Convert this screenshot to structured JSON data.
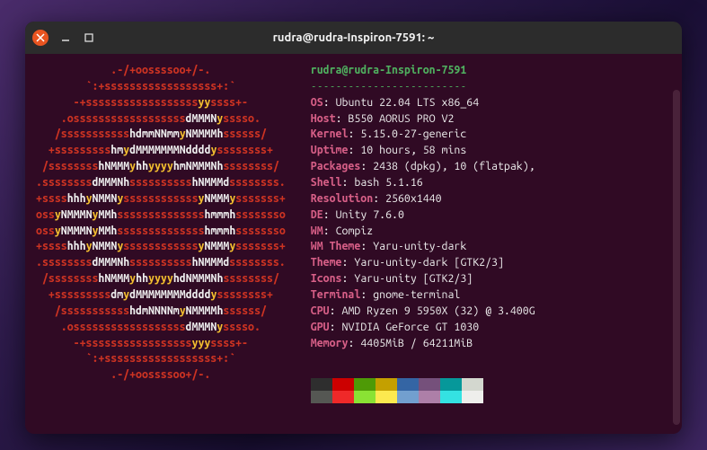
{
  "window": {
    "title": "rudra@rudra-Inspiron-7591: ~"
  },
  "neofetch": {
    "user_host": "rudra@rudra-Inspiron-7591",
    "separator": "-------------------------",
    "info": [
      {
        "key": "OS",
        "val": "Ubuntu 22.04 LTS x86_64"
      },
      {
        "key": "Host",
        "val": "B550 AORUS PRO V2"
      },
      {
        "key": "Kernel",
        "val": "5.15.0-27-generic"
      },
      {
        "key": "Uptime",
        "val": "10 hours, 58 mins"
      },
      {
        "key": "Packages",
        "val": "2438 (dpkg), 10 (flatpak),"
      },
      {
        "key": "Shell",
        "val": "bash 5.1.16"
      },
      {
        "key": "Resolution",
        "val": "2560x1440"
      },
      {
        "key": "DE",
        "val": "Unity 7.6.0"
      },
      {
        "key": "WM",
        "val": "Compiz"
      },
      {
        "key": "WM Theme",
        "val": "Yaru-unity-dark"
      },
      {
        "key": "Theme",
        "val": "Yaru-unity-dark [GTK2/3]"
      },
      {
        "key": "Icons",
        "val": "Yaru-unity [GTK2/3]"
      },
      {
        "key": "Terminal",
        "val": "gnome-terminal"
      },
      {
        "key": "CPU",
        "val": "AMD Ryzen 9 5950X (32) @ 3.400G"
      },
      {
        "key": "GPU",
        "val": "NVIDIA GeForce GT 1030"
      },
      {
        "key": "Memory",
        "val": "4405MiB / 64211MiB"
      }
    ],
    "palette_row1": [
      "#2e2e2e",
      "#cc0000",
      "#4e9a06",
      "#c4a000",
      "#3465a4",
      "#75507b",
      "#06989a",
      "#d3d7cf"
    ],
    "palette_row2": [
      "#555753",
      "#ef2929",
      "#8ae234",
      "#fce94f",
      "#729fcf",
      "#ad7fa8",
      "#34e2e2",
      "#eeeeec"
    ]
  },
  "logo_lines": [
    "            .-/+oossssoo+/-.",
    "        `:+ssssssssssssssssss+:`",
    "      -+ssssssssssssssssssyyssss+-",
    "    .ossssssssssssssssssdMMMNysssso.",
    "   /ssssssssssshdmmNNmmyNMMMMhssssss/",
    "  +ssssssssshmydMMMMMMMNddddyssssssss+",
    " /sssssssshNMMMyhhyyyyhmNMMMNhssssssss/",
    ".ssssssssdMMMNhsssssssssshNMMMdssssssss.",
    "+sssshhhyNMMNyssssssssssssyNMMMysssssss+",
    "ossyNMMMNyMMhsssssssssssssshmmmhssssssso",
    "ossyNMMMNyMMhsssssssssssssshmmmhssssssso",
    "+sssshhhyNMMNyssssssssssssyNMMMysssssss+",
    ".ssssssssdMMMNhsssssssssshNMMMdssssssss.",
    " /sssssssshNMMMyhhyyyyhdNMMMNhssssssss/",
    "  +sssssssssdmydMMMMMMMMddddyssssssss+",
    "   /ssssssssssshdmNNNNmyNMMMMhssssss/",
    "    .ossssssssssssssssssdMMMNysssso.",
    "      -+sssssssssssssssssyyyssss+-",
    "        `:+ssssssssssssssssss+:`",
    "            .-/+oossssoo+/-."
  ]
}
